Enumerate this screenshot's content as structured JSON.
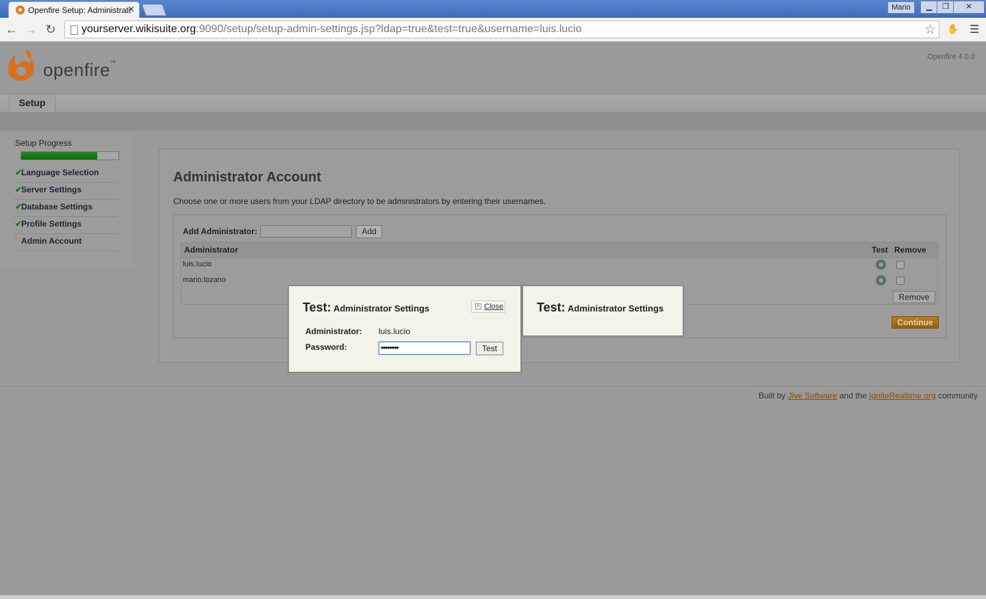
{
  "browser": {
    "tab_title": "Openfire Setup: Administrator",
    "user": "Mario",
    "url_host": "yourserver.wikisuite.org",
    "url_rest": ":9090/setup/setup-admin-settings.jsp?ldap=true&test=true&username=luis.lucio"
  },
  "header": {
    "logo_text": "openfire",
    "logo_tm": "™",
    "version": "Openfire 4.0.0"
  },
  "nav": {
    "setup_tab": "Setup"
  },
  "sidebar": {
    "progress_label": "Setup Progress",
    "progress_fraction": 0.78,
    "steps": [
      {
        "label": "Language Selection",
        "done": true
      },
      {
        "label": "Server Settings",
        "done": true
      },
      {
        "label": "Database Settings",
        "done": true
      },
      {
        "label": "Profile Settings",
        "done": true
      },
      {
        "label": "Admin Account",
        "done": false,
        "current": true
      }
    ]
  },
  "main": {
    "title": "Administrator Account",
    "description": "Choose one or more users from your LDAP directory to be administrators by entering their usernames.",
    "add_label": "Add Administrator:",
    "add_value": "",
    "add_button": "Add",
    "table": {
      "headers": {
        "admin": "Administrator",
        "test": "Test",
        "remove": "Remove"
      },
      "rows": [
        {
          "name": "luis.lucio"
        },
        {
          "name": "mario.lozano"
        }
      ]
    },
    "remove_button": "Remove",
    "continue_button": "Continue"
  },
  "footer": {
    "prefix": "Built by ",
    "link1": "Jive Software",
    "middle": " and the ",
    "link2": "IgniteRealtime.org",
    "suffix": " community"
  },
  "dialog": {
    "title_big": "Test:",
    "title_small": "Administrator Settings",
    "close_label": "Close",
    "admin_label": "Administrator:",
    "admin_value": "luis.lucio",
    "password_label": "Password:",
    "password_value": "••••••••",
    "test_button": "Test"
  },
  "dialog_secondary": {
    "title_big": "Test:",
    "title_small": "Administrator Settings"
  },
  "colors": {
    "accent": "#d9861a",
    "progress": "#1d8a1d",
    "link": "#8a4e08"
  }
}
